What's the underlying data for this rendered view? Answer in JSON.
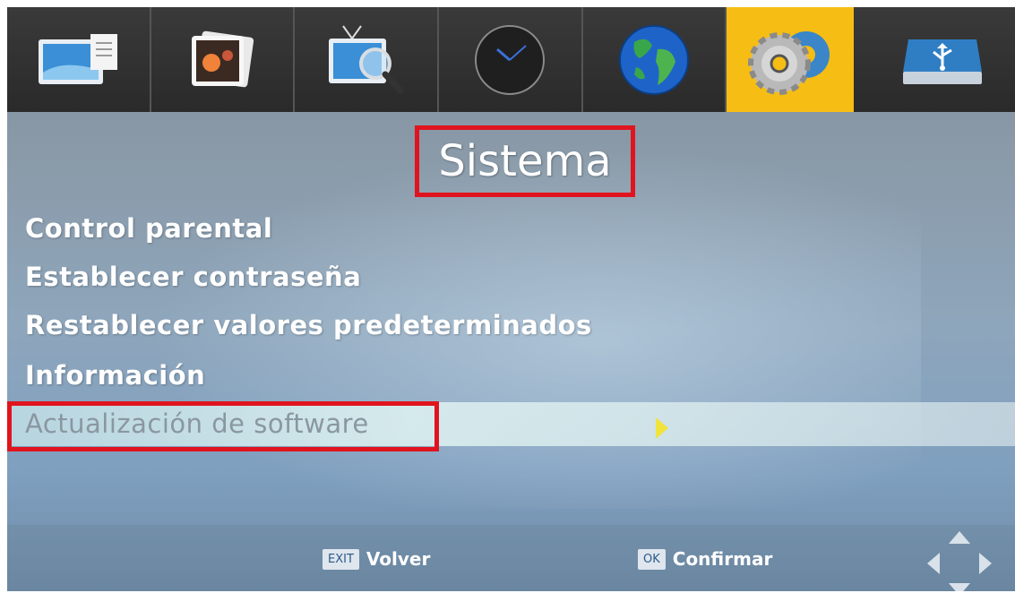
{
  "header": {
    "tabs": [
      {
        "icon": "picture-frame-icon"
      },
      {
        "icon": "photo-stack-icon"
      },
      {
        "icon": "tv-search-icon"
      },
      {
        "icon": "clock-icon"
      },
      {
        "icon": "globe-icon"
      },
      {
        "icon": "gear-settings-icon",
        "active": true
      },
      {
        "icon": "usb-drive-icon"
      }
    ]
  },
  "page": {
    "title": "Sistema"
  },
  "menu": {
    "items": [
      {
        "label": "Control parental"
      },
      {
        "label": "Establecer contraseña"
      },
      {
        "label": "Restablecer valores predeterminados"
      },
      {
        "label": "Información"
      },
      {
        "label": "Actualización de software",
        "selected": true
      }
    ]
  },
  "footer": {
    "back_key": "EXIT",
    "back_label": "Volver",
    "ok_key": "OK",
    "ok_label": "Confirmar"
  },
  "colors": {
    "active_tab": "#f6bd14",
    "highlight_border": "#e0141e",
    "selection_arrow": "#f1e33c"
  }
}
